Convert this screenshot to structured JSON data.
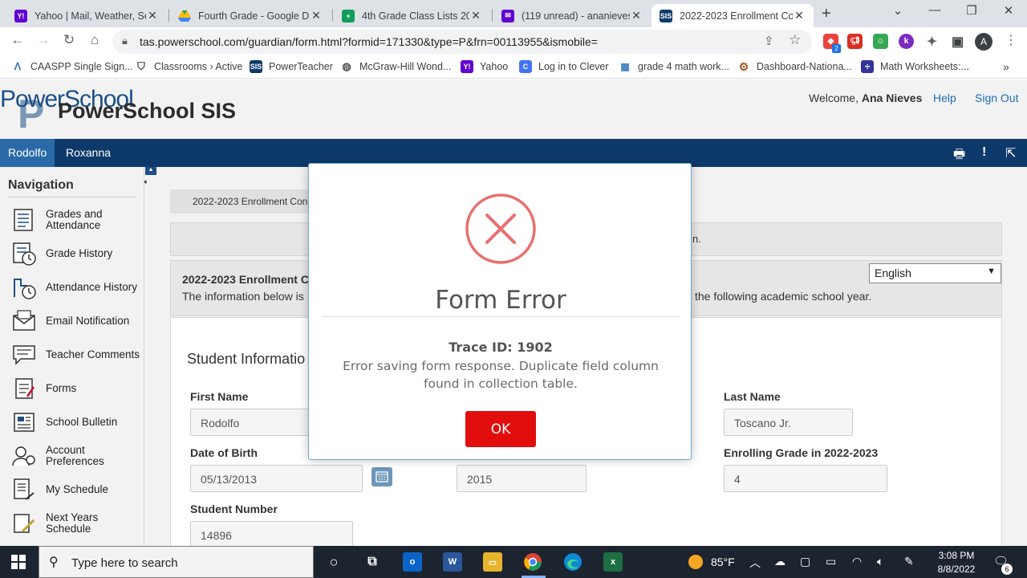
{
  "browser": {
    "tabs": [
      {
        "title": "Yahoo | Mail, Weather, Sea",
        "icon": "yahoo-icon",
        "color": "#6001d2"
      },
      {
        "title": "Fourth Grade - Google Dr",
        "icon": "google-drive-icon",
        "color": "#1fa463"
      },
      {
        "title": "4th Grade Class Lists 2022",
        "icon": "google-sheets-icon",
        "color": "#0f9d58"
      },
      {
        "title": "(119 unread) - ananieves@",
        "icon": "yahoo-mail-icon",
        "color": "#6001d2"
      },
      {
        "title": "2022-2023 Enrollment Co",
        "icon": "sis-icon",
        "color": "#0e3a6b"
      }
    ],
    "url": "tas.powerschool.com/guardian/form.html?formid=171330&type=P&frn=00113955&ismobile=",
    "extension_badge": "2",
    "profile_initial": "A",
    "bookmarks": [
      {
        "label": "CAASPP Single Sign...",
        "icon": "caaspp-icon",
        "color": "#2a6ebb"
      },
      {
        "label": "Classrooms › Active",
        "icon": "shield-icon",
        "color": "#444444"
      },
      {
        "label": "PowerTeacher",
        "icon": "sis-icon",
        "color": "#0e3a6b"
      },
      {
        "label": "McGraw-Hill Wond...",
        "icon": "globe-icon",
        "color": "#555555"
      },
      {
        "label": "Yahoo",
        "icon": "yahoo-icon",
        "color": "#6001d2"
      },
      {
        "label": "Log in to Clever",
        "icon": "clever-icon",
        "color": "#4274f6"
      },
      {
        "label": "grade 4 math work...",
        "icon": "math-icon",
        "color": "#3b7dbf"
      },
      {
        "label": "Dashboard-Nationa...",
        "icon": "gear-icon",
        "color": "#a05a2c"
      },
      {
        "label": "Math Worksheets:...",
        "icon": "divide-icon",
        "color": "#333399"
      }
    ]
  },
  "app": {
    "logo_top": "PowerSchool",
    "logo_main": "PowerSchool SIS",
    "welcome_prefix": "Welcome,",
    "user_name": "Ana Nieves",
    "help_label": "Help",
    "signout_label": "Sign Out",
    "students": [
      "Rodolfo",
      "Roxanna"
    ],
    "nav_title": "Navigation",
    "nav_items": [
      {
        "label": "Grades and Attendance",
        "icon": "grades-icon"
      },
      {
        "label": "Grade History",
        "icon": "grade-history-icon"
      },
      {
        "label": "Attendance History",
        "icon": "attendance-icon"
      },
      {
        "label": "Email Notification",
        "icon": "email-icon"
      },
      {
        "label": "Teacher Comments",
        "icon": "comments-icon"
      },
      {
        "label": "Forms",
        "icon": "forms-icon"
      },
      {
        "label": "School Bulletin",
        "icon": "bulletin-icon"
      },
      {
        "label": "Account Preferences",
        "icon": "account-icon"
      },
      {
        "label": "My Schedule",
        "icon": "schedule-icon"
      },
      {
        "label": "Next Years Schedule",
        "icon": "next-schedule-icon"
      }
    ],
    "breadcrumb": "2022-2023 Enrollment Con",
    "notice_tail": "n.",
    "form_title": "2022-2023 Enrollment C",
    "form_desc_start": "The information below is",
    "form_desc_end": "the following academic school year.",
    "language": "English",
    "section_title": "Student Informatio",
    "fields": {
      "first_name_label": "First Name",
      "first_name_value": "Rodolfo",
      "last_name_label": "Last Name",
      "last_name_value": "Toscano Jr.",
      "dob_label": "Date of Birth",
      "dob_value": "05/13/2013",
      "year_value": "2015",
      "grade_label": "Enrolling Grade in 2022-2023",
      "grade_value": "4",
      "student_number_label": "Student Number",
      "student_number_value": "14896"
    }
  },
  "modal": {
    "title": "Form Error",
    "trace": "Trace ID: 1902",
    "message": "Error saving form response. Duplicate field column found in collection table.",
    "ok_label": "OK",
    "error_color": "#e87070",
    "button_color": "#e20e0e"
  },
  "taskbar": {
    "search_placeholder": "Type here to search",
    "temperature": "85°F",
    "time": "3:08 PM",
    "date": "8/8/2022",
    "notifications": "6"
  }
}
